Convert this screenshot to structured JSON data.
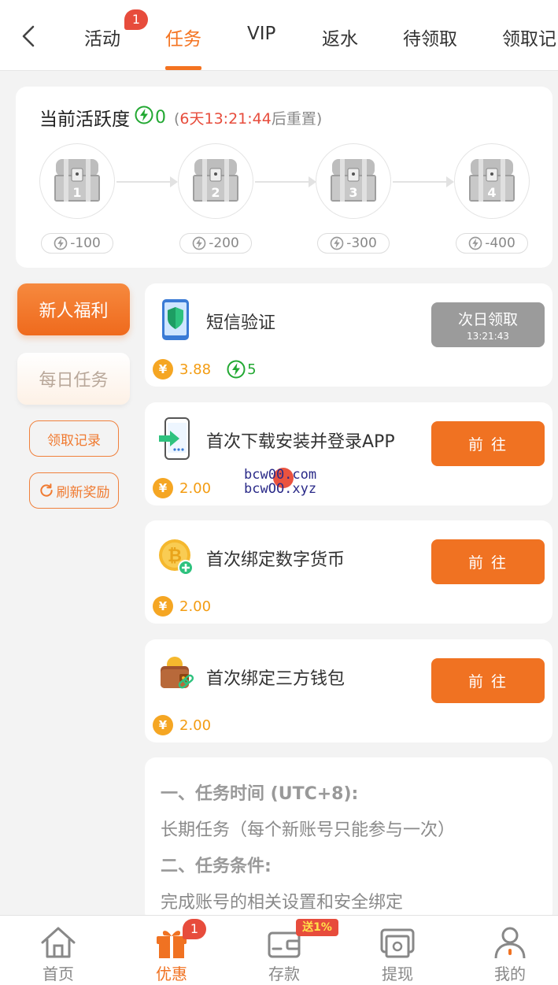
{
  "header": {
    "tabs": [
      {
        "label": "活动",
        "badge": "1"
      },
      {
        "label": "任务",
        "active": true
      },
      {
        "label": "VIP"
      },
      {
        "label": "返水"
      },
      {
        "label": "待领取"
      },
      {
        "label": "领取记"
      }
    ]
  },
  "activity": {
    "title": "当前活跃度",
    "value": "0",
    "paren_open": "(",
    "countdown": "6天13:21:44",
    "reset_suffix": "后重置)",
    "chests": [
      {
        "num": "1",
        "cost": "-100"
      },
      {
        "num": "2",
        "cost": "-200"
      },
      {
        "num": "3",
        "cost": "-300"
      },
      {
        "num": "4",
        "cost": "-400"
      }
    ]
  },
  "sidebar": {
    "new_welfare": "新人福利",
    "daily_tasks": "每日任务",
    "claim_history": "领取记录",
    "refresh_reward": "刷新奖励"
  },
  "tasks": [
    {
      "title": "短信验证",
      "reward": "3.88",
      "activity_points": "5",
      "button": "次日领取",
      "button_sub": "13:21:43",
      "icon": "phone-shield-icon"
    },
    {
      "title": "首次下载安装并登录APP",
      "reward": "2.00",
      "button": "前 往",
      "icon": "phone-download-icon"
    },
    {
      "title": "首次绑定数字货币",
      "reward": "2.00",
      "button": "前 往",
      "icon": "bitcoin-add-icon"
    },
    {
      "title": "首次绑定三方钱包",
      "reward": "2.00",
      "button": "前 往",
      "icon": "wallet-link-icon"
    }
  ],
  "watermark": {
    "line1": "bcw00.com",
    "line2": "bcwOO.xyz"
  },
  "rules": [
    {
      "text": "一、任务时间 (UTC+8):",
      "heading": true
    },
    {
      "text": "长期任务（每个新账号只能参与一次）"
    },
    {
      "text": "二、任务条件:",
      "heading": true
    },
    {
      "text": "完成账号的相关设置和安全绑定"
    }
  ],
  "bottom_nav": [
    {
      "label": "首页",
      "icon": "home-icon"
    },
    {
      "label": "优惠",
      "icon": "gift-icon",
      "badge": "1",
      "active": true
    },
    {
      "label": "存款",
      "icon": "wallet-icon",
      "tag": "送1%"
    },
    {
      "label": "提现",
      "icon": "withdraw-icon"
    },
    {
      "label": "我的",
      "icon": "user-icon"
    }
  ],
  "colors": {
    "accent": "#f07222",
    "green": "#22a832",
    "red": "#e74c3c",
    "coin": "#f5a623"
  }
}
